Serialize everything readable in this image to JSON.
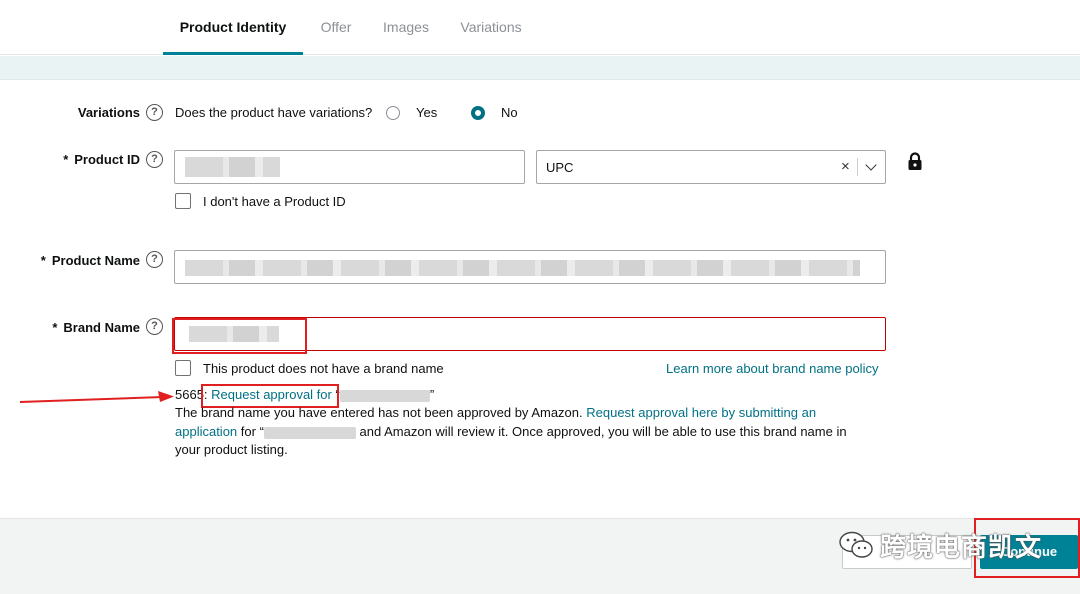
{
  "tabs": [
    {
      "label": "Product Identity",
      "active": true
    },
    {
      "label": "Offer",
      "active": false
    },
    {
      "label": "Images",
      "active": false
    },
    {
      "label": "Variations",
      "active": false
    }
  ],
  "variations": {
    "label": "Variations",
    "question": "Does the product have variations?",
    "options": [
      "Yes",
      "No"
    ],
    "selected": "No"
  },
  "product_id": {
    "label": "Product ID",
    "required_mark": "*",
    "type_value": "UPC",
    "no_id_checkbox": "I don't have a Product ID"
  },
  "product_name": {
    "label": "Product Name",
    "required_mark": "*"
  },
  "brand_name": {
    "label": "Brand Name",
    "required_mark": "*",
    "no_brand_checkbox": "This product does not have a brand name",
    "policy_link": "Learn more about brand name policy"
  },
  "error": {
    "code": "5665",
    "code_sep": ":",
    "request_link": "Request approval for",
    "quote_open": "“",
    "quote_close": "”",
    "line2_text": "The brand name you have entered has not been approved by Amazon.",
    "line2_link": "Request approval here by submitting an",
    "line3_link": "application",
    "line3_text_a": "for “",
    "line3_text_b": "and Amazon will review it. Once approved, you will be able to use this brand name in",
    "line4_text": "your product listing."
  },
  "footer": {
    "continue_label": "Continue",
    "watermark": "跨境电商凯文"
  },
  "colors": {
    "accent": "#008296",
    "link": "#007185",
    "error": "#c40000",
    "annotation": "#e02020"
  },
  "icons": {
    "help": "question-circle-icon",
    "lock": "lock-icon",
    "clear": "x-icon",
    "chevron": "chevron-down-icon",
    "wechat": "wechat-icon"
  }
}
